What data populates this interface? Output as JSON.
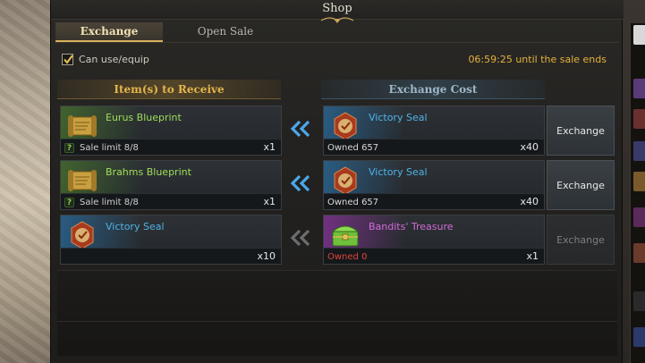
{
  "window": {
    "title": "Shop"
  },
  "tabs": [
    {
      "label": "Exchange",
      "active": true
    },
    {
      "label": "Open Sale",
      "active": false
    }
  ],
  "filter": {
    "label": "Can use/equip",
    "checked": true
  },
  "timer": {
    "text": "06:59:25 until the sale ends"
  },
  "headers": {
    "receive": "Item(s) to Receive",
    "cost": "Exchange Cost"
  },
  "colors": {
    "accent_gold": "#e3b64b",
    "timer": "#e5b13c",
    "uncommon_green": "#9fde5a",
    "rare_blue": "#4fb3e8",
    "epic_purple": "#d36ad8",
    "insufficient_red": "#e0463c"
  },
  "rows": [
    {
      "receive": {
        "name": "Eurus Blueprint",
        "icon": "blueprint-scroll-icon",
        "rarity": "green",
        "limit_badge": "?",
        "limit": "Sale limit 8/8",
        "qty": "x1"
      },
      "cost": {
        "name": "Victory Seal",
        "icon": "victory-seal-icon",
        "rarity": "blue",
        "owned": "Owned 657",
        "qty": "x40"
      },
      "button": "Exchange",
      "enabled": true
    },
    {
      "receive": {
        "name": "Brahms Blueprint",
        "icon": "blueprint-scroll-icon",
        "rarity": "green",
        "limit_badge": "?",
        "limit": "Sale limit 8/8",
        "qty": "x1"
      },
      "cost": {
        "name": "Victory Seal",
        "icon": "victory-seal-icon",
        "rarity": "blue",
        "owned": "Owned 657",
        "qty": "x40"
      },
      "button": "Exchange",
      "enabled": true
    },
    {
      "receive": {
        "name": "Victory Seal",
        "icon": "victory-seal-icon",
        "rarity": "blue",
        "limit": "",
        "qty": "x10"
      },
      "cost": {
        "name": "Bandits' Treasure",
        "icon": "treasure-chest-icon",
        "rarity": "purple",
        "owned": "Owned 0",
        "qty": "x1"
      },
      "button": "Exchange",
      "enabled": false
    }
  ]
}
